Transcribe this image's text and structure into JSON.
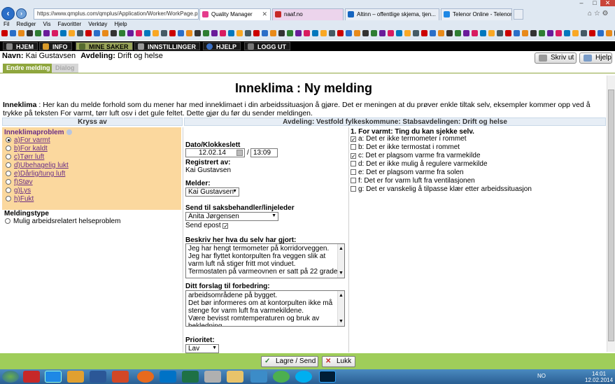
{
  "browser": {
    "address": "https://www.qmplus.com/qmplus/Application/Worker/WorkPage.px",
    "tabs": [
      {
        "label": "Quality Manager",
        "color": "#e53c8c"
      },
      {
        "label": "naaf.no",
        "color": "#c62828"
      },
      {
        "label": "Altinn – offentlige skjema, tjen...",
        "color": "#1565c0"
      },
      {
        "label": "Telenor Online - Telenor",
        "color": "#1e88e5"
      }
    ],
    "menu": [
      "Fil",
      "Rediger",
      "Vis",
      "Favoritter",
      "Verktøy",
      "Hjelp"
    ]
  },
  "appnav": {
    "items": [
      {
        "label": "HJEM",
        "active": false
      },
      {
        "label": "INFO",
        "active": false
      },
      {
        "label": "MINE SAKER",
        "active": true
      },
      {
        "label": "INNSTILLINGER",
        "active": false
      },
      {
        "label": "HJELP",
        "active": false
      },
      {
        "label": "LOGG UT",
        "active": false
      }
    ]
  },
  "info": {
    "name_label": "Navn:",
    "name_value": "Kai Gustavsen",
    "dept_label": "Avdeling:",
    "dept_value": "Drift og helse",
    "print_btn": "Skriv ut",
    "help_btn": "Hjelp"
  },
  "subtabs": {
    "active": "Endre melding",
    "inactive": "Dialog"
  },
  "page": {
    "title": "Inneklima : Ny melding",
    "intro_bold": "Inneklima",
    "intro_text": " : Her kan du melde forhold som du mener har med inneklimaet i din arbeidssituasjon å gjøre. Det er meningen at du prøver enkle tiltak selv, eksempler kommer opp ved å trykke på teksten For varmt, tørr luft osv i det gule feltet. Dette gjør du før du sender meldingen."
  },
  "headers": {
    "left": "Kryss av",
    "right": "Avdeling: Vestfold fylkeskommune: Stabsavdelingen: Drift og helse"
  },
  "problems": {
    "title": "Inneklimaproblem",
    "selected_index": 0,
    "items": [
      "a)For varmt",
      "b)For kaldt",
      "c)Tørr luft",
      "d)Ubehagelig lukt",
      "e)Dårlig/tung luft",
      "f)Støv",
      "g)Lys",
      "h)Fukt"
    ]
  },
  "meldingstype": {
    "title": "Meldingstype",
    "option": "Mulig arbeidsrelatert helseproblem"
  },
  "form": {
    "date_label": "Dato/Klokkeslett",
    "date_value": "12.02.14",
    "time_sep": "/",
    "time_value": "13:09",
    "registered_label": "Registrert av:",
    "registered_value": "Kai Gustavsen",
    "melder_label": "Melder:",
    "melder_value": "Kai Gustavsen",
    "send_label": "Send til saksbehandler/linjeleder",
    "send_value": "Anita Jørgensen",
    "send_email_label": "Send epost",
    "send_email_checked": true,
    "describe_label": "Beskriv her hva du selv har gjort:",
    "describe_lines": [
      "Jeg har hengt termometer på korridorveggen.",
      "Jeg har flyttet kontorpulten fra veggen slik at",
      "varm luft nå stiger fritt mot vinduet.",
      "Termostaten på varmeovnen er satt på 22 grader"
    ],
    "suggest_label": "Ditt forslag til forbedring:",
    "suggest_lines": [
      "arbeidsområdene på bygget.",
      "Det bør informeres om at kontorpulten ikke må",
      "stenge for varm luft fra varmekildene.",
      "Være bevisst romtemperaturen og bruk av",
      "bekledning."
    ],
    "priority_label": "Prioritet:",
    "priority_value": "Lav"
  },
  "checklist": {
    "title": "1. For varmt: Ting du kan sjekke selv.",
    "items": [
      {
        "label": "a: Det er ikke termometer i rommet",
        "checked": true
      },
      {
        "label": "b: Det er ikke termostat i rommet",
        "checked": false
      },
      {
        "label": "c: Det er plagsom varme fra varmekilde",
        "checked": true
      },
      {
        "label": "d: Det er ikke mulig å regulere varmekilde",
        "checked": false
      },
      {
        "label": "e: Det er plagsom varme fra solen",
        "checked": false
      },
      {
        "label": "f: Det er for varm luft fra ventilasjonen",
        "checked": false
      },
      {
        "label": "g: Det er vanskelig å tilpasse klær etter arbeidssituasjon",
        "checked": false
      }
    ]
  },
  "buttons": {
    "save": "Lagre / Send",
    "close": "Lukk"
  },
  "taskbar": {
    "locale": "NO",
    "time": "14:01",
    "date": "12.02.2014"
  }
}
